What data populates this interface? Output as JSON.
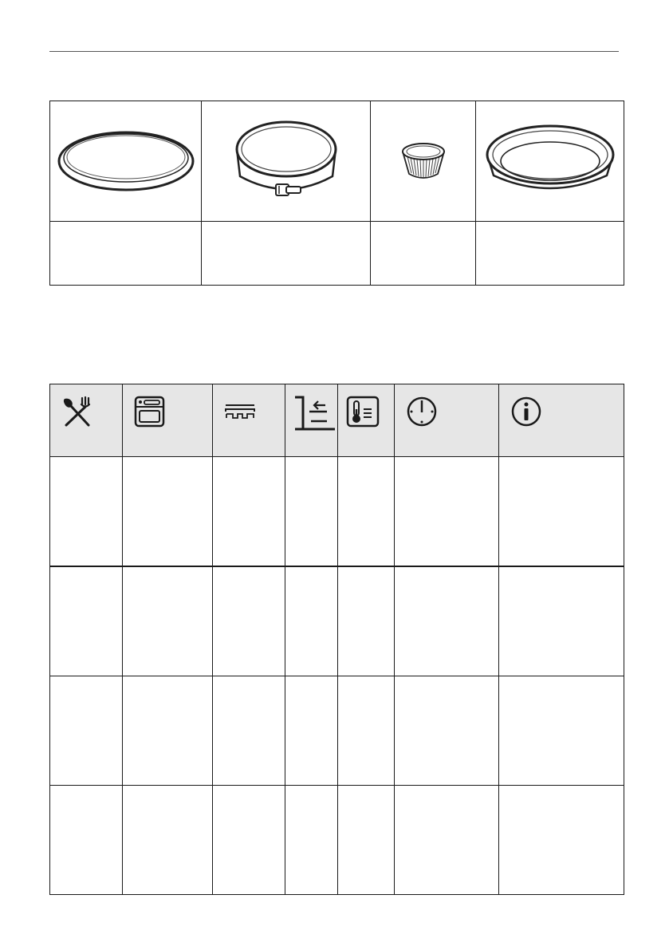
{
  "bakeware": {
    "items": [
      {
        "icon": "flat-baking-tray-icon",
        "label": ""
      },
      {
        "icon": "springform-pan-icon",
        "label": ""
      },
      {
        "icon": "ramekin-icon",
        "label": ""
      },
      {
        "icon": "flan-base-pan-icon",
        "label": ""
      }
    ]
  },
  "settings_table": {
    "header_icons": [
      "cutlery-icon",
      "oven-function-icon",
      "heating-element-icon",
      "shelf-position-icon",
      "temperature-icon",
      "clock-icon",
      "info-icon"
    ],
    "rows": [
      [
        "",
        "",
        "",
        "",
        "",
        "",
        ""
      ],
      [
        "",
        "",
        "",
        "",
        "",
        "",
        ""
      ],
      [
        "",
        "",
        "",
        "",
        "",
        "",
        ""
      ],
      [
        "",
        "",
        "",
        "",
        "",
        "",
        ""
      ]
    ]
  }
}
